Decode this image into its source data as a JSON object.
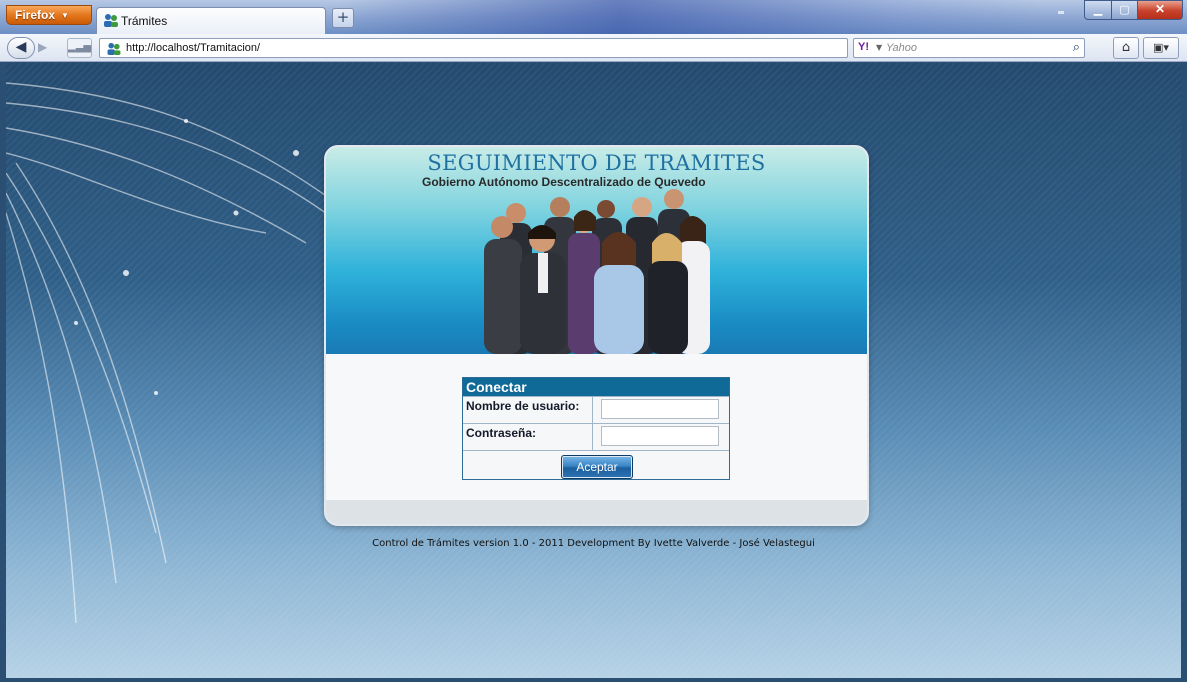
{
  "browser": {
    "menu_button": "Firefox",
    "tab_title": "Trámites",
    "new_tab": "+",
    "url": "http://localhost/Tramitacion/",
    "search_placeholder": "Yahoo"
  },
  "banner": {
    "title": "SEGUIMIENTO DE TRAMITES",
    "subtitle": "Gobierno Autónomo Descentralizado de Quevedo"
  },
  "login": {
    "header": "Conectar",
    "username_label": "Nombre de usuario:",
    "username_value": "",
    "password_label": "Contraseña:",
    "password_value": "",
    "submit_label": "Aceptar"
  },
  "footer": {
    "text": "Control de Trámites version 1.0 - 2011 Development By Ivette Valverde - José Velastegui"
  },
  "colors": {
    "header_blue": "#0f6a98",
    "banner_title": "#1f71a2",
    "firefox_orange": "#e2741a"
  }
}
